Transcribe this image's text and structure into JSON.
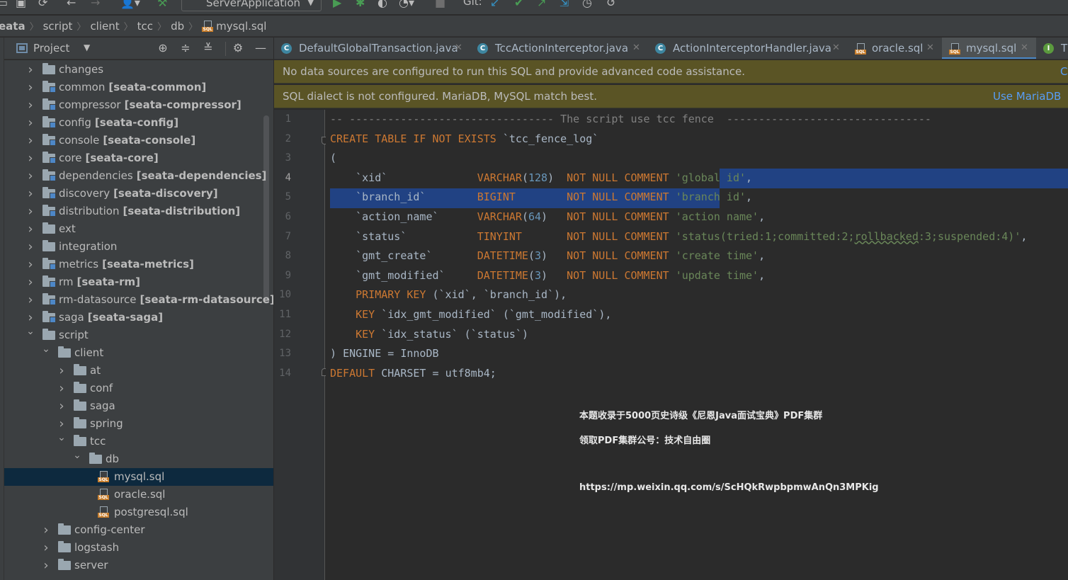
{
  "toolbar": {
    "run_config": "ServerApplication",
    "git_label": "Git:"
  },
  "breadcrumb": [
    "eata",
    "script",
    "client",
    "tcc",
    "db",
    "mysql.sql"
  ],
  "project_panel": {
    "title": "Project",
    "tree": [
      {
        "label": "changes",
        "suffix": "",
        "depth": 0,
        "expanded": false,
        "type": "folder"
      },
      {
        "label": "common",
        "suffix": "[seata-common]",
        "depth": 0,
        "expanded": false,
        "type": "module"
      },
      {
        "label": "compressor",
        "suffix": "[seata-compressor]",
        "depth": 0,
        "expanded": false,
        "type": "module"
      },
      {
        "label": "config",
        "suffix": "[seata-config]",
        "depth": 0,
        "expanded": false,
        "type": "module"
      },
      {
        "label": "console",
        "suffix": "[seata-console]",
        "depth": 0,
        "expanded": false,
        "type": "module"
      },
      {
        "label": "core",
        "suffix": "[seata-core]",
        "depth": 0,
        "expanded": false,
        "type": "module"
      },
      {
        "label": "dependencies",
        "suffix": "[seata-dependencies]",
        "depth": 0,
        "expanded": false,
        "type": "module"
      },
      {
        "label": "discovery",
        "suffix": "[seata-discovery]",
        "depth": 0,
        "expanded": false,
        "type": "module"
      },
      {
        "label": "distribution",
        "suffix": "[seata-distribution]",
        "depth": 0,
        "expanded": false,
        "type": "module"
      },
      {
        "label": "ext",
        "suffix": "",
        "depth": 0,
        "expanded": false,
        "type": "folder"
      },
      {
        "label": "integration",
        "suffix": "",
        "depth": 0,
        "expanded": false,
        "type": "folder"
      },
      {
        "label": "metrics",
        "suffix": "[seata-metrics]",
        "depth": 0,
        "expanded": false,
        "type": "module"
      },
      {
        "label": "rm",
        "suffix": "[seata-rm]",
        "depth": 0,
        "expanded": false,
        "type": "module"
      },
      {
        "label": "rm-datasource",
        "suffix": "[seata-rm-datasource]",
        "depth": 0,
        "expanded": false,
        "type": "module"
      },
      {
        "label": "saga",
        "suffix": "[seata-saga]",
        "depth": 0,
        "expanded": false,
        "type": "module"
      },
      {
        "label": "script",
        "suffix": "",
        "depth": 0,
        "expanded": true,
        "type": "folder"
      },
      {
        "label": "client",
        "suffix": "",
        "depth": 1,
        "expanded": true,
        "type": "folder"
      },
      {
        "label": "at",
        "suffix": "",
        "depth": 2,
        "expanded": false,
        "type": "folder"
      },
      {
        "label": "conf",
        "suffix": "",
        "depth": 2,
        "expanded": false,
        "type": "folder"
      },
      {
        "label": "saga",
        "suffix": "",
        "depth": 2,
        "expanded": false,
        "type": "folder"
      },
      {
        "label": "spring",
        "suffix": "",
        "depth": 2,
        "expanded": false,
        "type": "folder"
      },
      {
        "label": "tcc",
        "suffix": "",
        "depth": 2,
        "expanded": true,
        "type": "folder"
      },
      {
        "label": "db",
        "suffix": "",
        "depth": 3,
        "expanded": true,
        "type": "folder"
      },
      {
        "label": "mysql.sql",
        "suffix": "",
        "depth": 4,
        "expanded": null,
        "type": "sql",
        "selected": true
      },
      {
        "label": "oracle.sql",
        "suffix": "",
        "depth": 4,
        "expanded": null,
        "type": "sql"
      },
      {
        "label": "postgresql.sql",
        "suffix": "",
        "depth": 4,
        "expanded": null,
        "type": "sql"
      },
      {
        "label": "config-center",
        "suffix": "",
        "depth": 1,
        "expanded": false,
        "type": "folder"
      },
      {
        "label": "logstash",
        "suffix": "",
        "depth": 1,
        "expanded": false,
        "type": "folder"
      },
      {
        "label": "server",
        "suffix": "",
        "depth": 1,
        "expanded": false,
        "type": "folder"
      }
    ]
  },
  "editor_tabs": [
    {
      "label": "DefaultGlobalTransaction.java",
      "icon": "class-icon",
      "active": false
    },
    {
      "label": "TccActionInterceptor.java",
      "icon": "class-icon",
      "active": false
    },
    {
      "label": "ActionInterceptorHandler.java",
      "icon": "class-icon",
      "active": false
    },
    {
      "label": "oracle.sql",
      "icon": "sql-file-icon",
      "active": false
    },
    {
      "label": "mysql.sql",
      "icon": "sql-file-icon",
      "active": true
    },
    {
      "label": "T",
      "icon": "interface-icon",
      "active": false
    }
  ],
  "banners": {
    "no_datasource": {
      "message": "No data sources are configured to run this SQL and provide advanced code assistance.",
      "action": "C"
    },
    "dialect": {
      "message": "SQL dialect is not configured. MariaDB, MySQL match best.",
      "action": "Use MariaDB"
    }
  },
  "code_lines": [
    "-- -------------------------------- The script use tcc fence  --------------------------------",
    "CREATE TABLE IF NOT EXISTS `tcc_fence_log`",
    "(",
    "    `xid`              VARCHAR(128)  NOT NULL COMMENT 'global id',",
    "    `branch_id`        BIGINT        NOT NULL COMMENT 'branch id',",
    "    `action_name`      VARCHAR(64)   NOT NULL COMMENT 'action name',",
    "    `status`           TINYINT       NOT NULL COMMENT 'status(tried:1;committed:2;rollbacked:3;suspended:4)',",
    "    `gmt_create`       DATETIME(3)   NOT NULL COMMENT 'create time',",
    "    `gmt_modified`     DATETIME(3)   NOT NULL COMMENT 'update time',",
    "    PRIMARY KEY (`xid`, `branch_id`),",
    "    KEY `idx_gmt_modified` (`gmt_modified`),",
    "    KEY `idx_status` (`status`)",
    ") ENGINE = InnoDB",
    "DEFAULT CHARSET = utf8mb4;"
  ],
  "line_numbers": [
    "1",
    "2",
    "3",
    "4",
    "5",
    "6",
    "7",
    "8",
    "9",
    "10",
    "11",
    "12",
    "13",
    "14"
  ],
  "watermark": {
    "line1": "本题收录于5000页史诗级《尼恩Java面试宝典》PDF集群",
    "line2": "领取PDF集群公号：技术自由圈",
    "line3": "https://mp.weixin.qq.com/s/ScHQkRwpbpmwAnQn3MPKig"
  },
  "colors": {
    "keyword": "#cc7832",
    "string": "#6a8759",
    "number": "#6897bb",
    "comment": "#808080",
    "selection": "#214283",
    "banner": "#5a5425",
    "link": "#589df6"
  }
}
